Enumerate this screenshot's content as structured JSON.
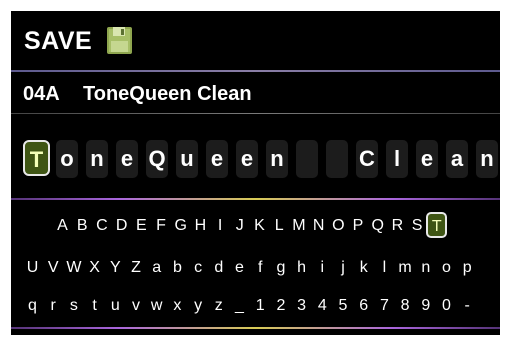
{
  "header": {
    "title": "SAVE",
    "icon": "floppy-disk-icon"
  },
  "preset": {
    "number": "04A",
    "name": "ToneQueen Clean"
  },
  "name_slots": [
    "T",
    "o",
    "n",
    "e",
    "Q",
    "u",
    "e",
    "e",
    "n",
    " ",
    " ",
    "C",
    "l",
    "e",
    "a",
    "n"
  ],
  "active_slot_index": 0,
  "keyboard": {
    "rows": [
      [
        "A",
        "B",
        "C",
        "D",
        "E",
        "F",
        "G",
        "H",
        "I",
        "J",
        "K",
        "L",
        "M",
        "N",
        "O",
        "P",
        "Q",
        "R",
        "S",
        "T"
      ],
      [
        "U",
        "V",
        "W",
        "X",
        "Y",
        "Z",
        "a",
        "b",
        "c",
        "d",
        "e",
        "f",
        "g",
        "h",
        "i",
        "j",
        "k",
        "l",
        "m",
        "n",
        "o",
        "p"
      ],
      [
        "q",
        "r",
        "s",
        "t",
        "u",
        "v",
        "w",
        "x",
        "y",
        "z",
        "_",
        "1",
        "2",
        "3",
        "4",
        "5",
        "6",
        "7",
        "8",
        "9",
        "0",
        "-"
      ]
    ],
    "selected_key": "T"
  },
  "colors": {
    "active_fill": "#3f5514",
    "active_text": "#f4ffb8",
    "background": "#000000"
  }
}
